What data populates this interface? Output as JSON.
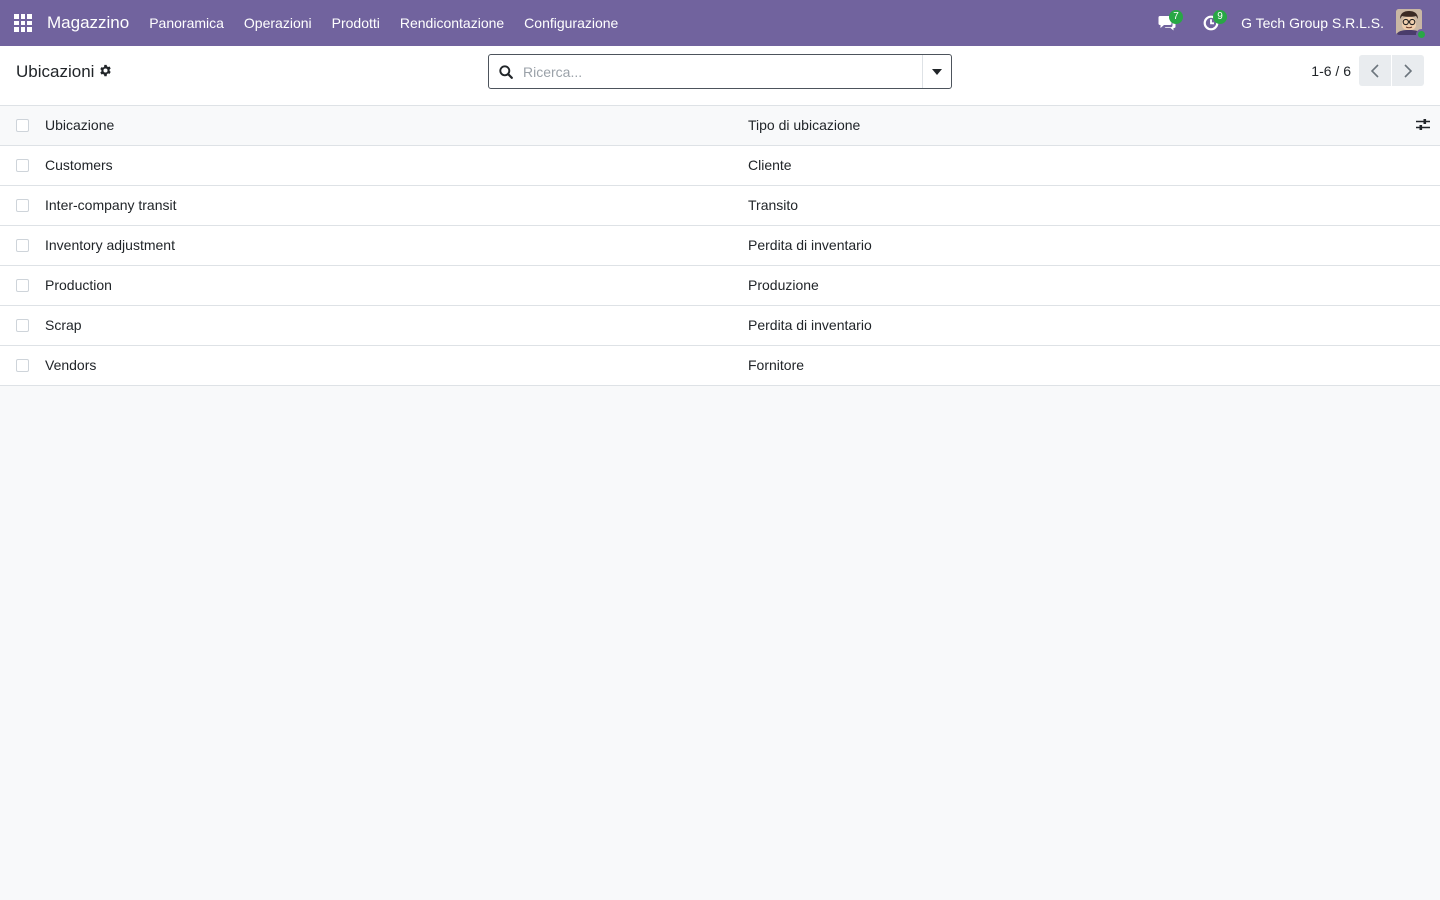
{
  "navbar": {
    "app_name": "Magazzino",
    "menu": [
      {
        "label": "Panoramica"
      },
      {
        "label": "Operazioni"
      },
      {
        "label": "Prodotti"
      },
      {
        "label": "Rendicontazione"
      },
      {
        "label": "Configurazione"
      }
    ],
    "messages_count": "7",
    "activities_count": "9",
    "company": "G Tech Group S.R.L.S.",
    "color": "#71639e"
  },
  "control_panel": {
    "title": "Ubicazioni",
    "search_placeholder": "Ricerca...",
    "pager": "1-6 / 6"
  },
  "list": {
    "columns": [
      "Ubicazione",
      "Tipo di ubicazione"
    ],
    "rows": [
      {
        "name": "Customers",
        "type": "Cliente"
      },
      {
        "name": "Inter-company transit",
        "type": "Transito"
      },
      {
        "name": "Inventory adjustment",
        "type": "Perdita di inventario"
      },
      {
        "name": "Production",
        "type": "Produzione"
      },
      {
        "name": "Scrap",
        "type": "Perdita di inventario"
      },
      {
        "name": "Vendors",
        "type": "Fornitore"
      }
    ]
  }
}
